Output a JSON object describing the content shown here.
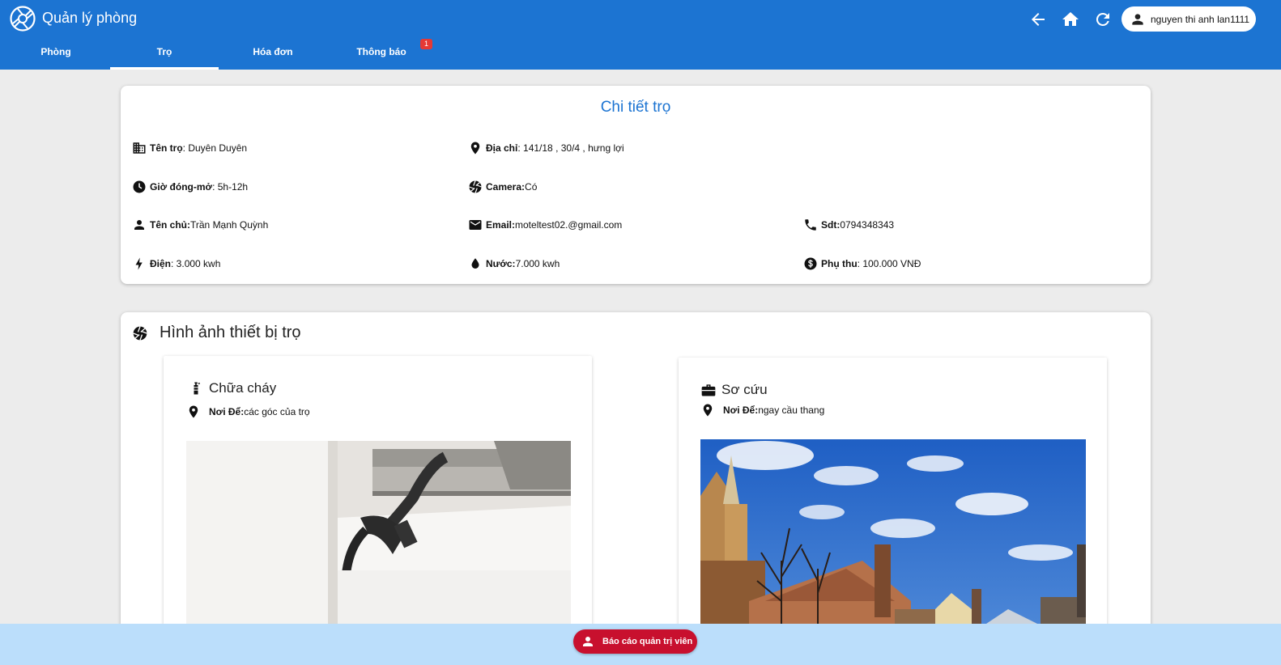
{
  "header": {
    "app_title": "Quản lý phòng",
    "user_name": "nguyen thi anh lan1111",
    "icons": [
      "logo-icon",
      "back-arrow-icon",
      "home-icon",
      "refresh-icon",
      "person-icon"
    ],
    "tabs": [
      {
        "label": "Phòng"
      },
      {
        "label": "Trọ",
        "active": true
      },
      {
        "label": "Hóa đơn"
      },
      {
        "label": "Thông báo",
        "badge": "1"
      }
    ],
    "brand_color": "#1c74d2"
  },
  "detail": {
    "title": "Chi tiết trọ",
    "fields": {
      "name": {
        "label": "Tên trọ",
        "value": ": Duyên Duyên"
      },
      "address": {
        "label": "Địa chỉ",
        "value": ": 141/18 , 30/4 , hưng lợi"
      },
      "hours": {
        "label": "Giờ đóng-mở",
        "value": ": 5h-12h"
      },
      "camera": {
        "label": "Camera:",
        "value": " Có"
      },
      "owner": {
        "label": "Tên chủ:",
        "value": "Trần Mạnh Quỳnh"
      },
      "email": {
        "label": "Email:",
        "value": " moteltest02.@gmail.com"
      },
      "phone": {
        "label": "Sdt:",
        "value": " 0794348343"
      },
      "electric": {
        "label": "Điện",
        "value": ": 3.000 kwh"
      },
      "water": {
        "label": "Nước:",
        "value": " 7.000 kwh"
      },
      "surcharge": {
        "label": "Phụ thu",
        "value": ": 100.000 VNĐ"
      }
    }
  },
  "equipment": {
    "title": "Hình ảnh thiết bị trọ",
    "items": [
      {
        "name": "Chữa cháy",
        "location_label": "Nơi Để:",
        "location": " các góc của trọ",
        "icon": "fire-extinguisher-icon"
      },
      {
        "name": "Sơ cứu",
        "location_label": "Nơi Để:",
        "location": " ngay cầu thang",
        "icon": "first-aid-kit-icon"
      }
    ]
  },
  "footer": {
    "report_label": "Báo cáo quản trị viên",
    "report_color": "#c8102e"
  }
}
